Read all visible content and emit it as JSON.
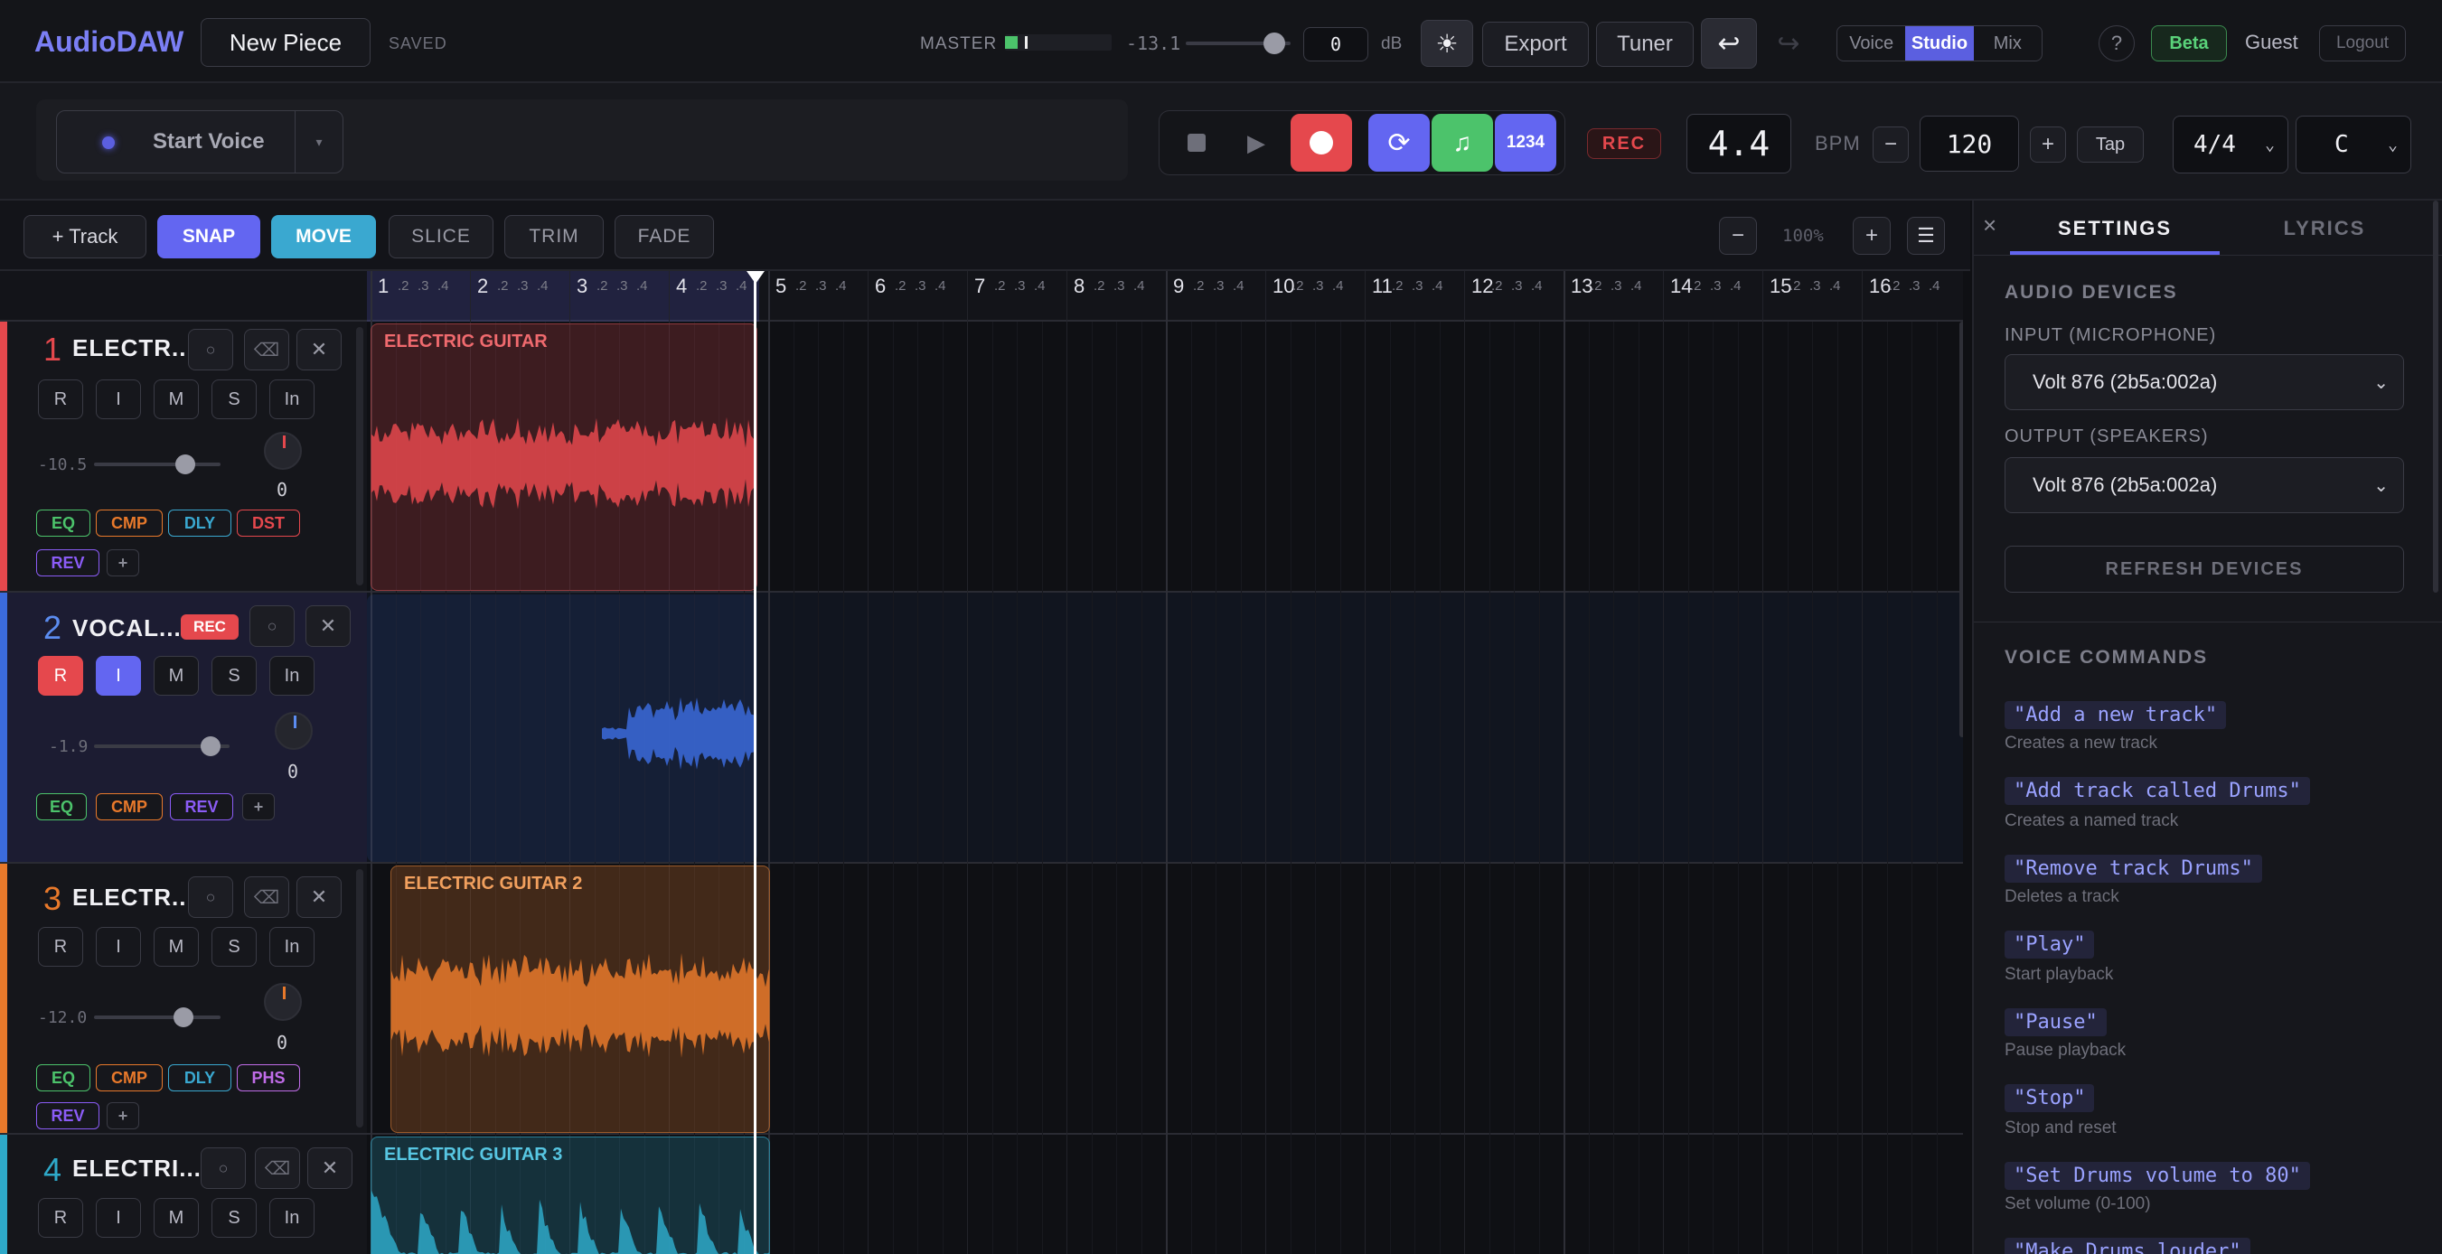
{
  "colors": {
    "accent": "#6366f1",
    "red": "#e5484d",
    "blue": "#3b6bdc",
    "orange": "#e8792b",
    "teal": "#2ea9c9",
    "green": "#4cc36b"
  },
  "header": {
    "logo": "AudioDAW",
    "project_name": "New Piece",
    "save_status": "SAVED",
    "master_label": "MASTER",
    "master_db": "-13.1",
    "master_gain": "0",
    "db_unit": "dB",
    "theme_icon": "sun-icon",
    "export_label": "Export",
    "tuner_label": "Tuner",
    "undo_icon": "undo-icon",
    "redo_icon": "redo-icon",
    "modes": [
      "Voice",
      "Studio",
      "Mix"
    ],
    "active_mode": "Studio",
    "help_label": "?",
    "beta_label": "Beta",
    "user_label": "Guest",
    "logout_label": "Logout"
  },
  "transport": {
    "start_voice_label": "Start Voice",
    "rec_label": "REC",
    "position": "4.4",
    "bpm_label": "BPM",
    "bpm_minus": "−",
    "bpm_value": "120",
    "bpm_plus": "+",
    "tap_label": "Tap",
    "time_signature": "4/4",
    "key": "C",
    "count_in_label": "1234"
  },
  "toolbar": {
    "add_track_label": "+ Track",
    "snap_label": "SNAP",
    "move_label": "MOVE",
    "slice_label": "SLICE",
    "trim_label": "TRIM",
    "fade_label": "FADE",
    "zoom_out": "−",
    "zoom_value": "100%",
    "zoom_in": "+"
  },
  "ruler": {
    "bars": [
      "1",
      "2",
      "3",
      "4",
      "5",
      "6",
      "7",
      "8",
      "9",
      "10",
      "11",
      "12",
      "13",
      "14",
      "15",
      "16"
    ],
    "subs": [
      ".2",
      ".3",
      ".4"
    ]
  },
  "tracks": [
    {
      "num": "1",
      "name": "ELECTR...",
      "volume": "-10.5",
      "pan": "0",
      "buttons": [
        "R",
        "I",
        "M",
        "S",
        "In"
      ],
      "fx": [
        "EQ",
        "CMP",
        "DLY",
        "DST",
        "REV"
      ],
      "clip_label": "ELECTRIC GUITAR"
    },
    {
      "num": "2",
      "name": "VOCAL...",
      "rec_badge": "REC",
      "volume": "-1.9",
      "pan": "0",
      "buttons": [
        "R",
        "I",
        "M",
        "S",
        "In"
      ],
      "fx": [
        "EQ",
        "CMP",
        "REV"
      ],
      "clip_label": ""
    },
    {
      "num": "3",
      "name": "ELECTR...",
      "volume": "-12.0",
      "pan": "0",
      "buttons": [
        "R",
        "I",
        "M",
        "S",
        "In"
      ],
      "fx": [
        "EQ",
        "CMP",
        "DLY",
        "PHS",
        "REV"
      ],
      "clip_label": "ELECTRIC GUITAR 2"
    },
    {
      "num": "4",
      "name": "ELECTRI...",
      "volume": "",
      "pan": "",
      "buttons": [
        "R",
        "I",
        "M",
        "S",
        "In"
      ],
      "fx": [],
      "clip_label": "ELECTRIC GUITAR 3"
    }
  ],
  "panel": {
    "close_label": "×",
    "tabs": [
      "SETTINGS",
      "LYRICS"
    ],
    "active_tab": "SETTINGS",
    "audio_devices_title": "AUDIO DEVICES",
    "input_label": "INPUT (MICROPHONE)",
    "input_value": "Volt 876 (2b5a:002a)",
    "output_label": "OUTPUT (SPEAKERS)",
    "output_value": "Volt 876 (2b5a:002a)",
    "refresh_label": "REFRESH DEVICES",
    "voice_commands_title": "VOICE COMMANDS",
    "commands": [
      {
        "cmd": "\"Add a new track\"",
        "desc": "Creates a new track"
      },
      {
        "cmd": "\"Add track called Drums\"",
        "desc": "Creates a named track"
      },
      {
        "cmd": "\"Remove track Drums\"",
        "desc": "Deletes a track"
      },
      {
        "cmd": "\"Play\"",
        "desc": "Start playback"
      },
      {
        "cmd": "\"Pause\"",
        "desc": "Pause playback"
      },
      {
        "cmd": "\"Stop\"",
        "desc": "Stop and reset"
      },
      {
        "cmd": "\"Set Drums volume to 80\"",
        "desc": "Set volume (0-100)"
      },
      {
        "cmd": "\"Make Drums louder\"",
        "desc": ""
      }
    ]
  }
}
